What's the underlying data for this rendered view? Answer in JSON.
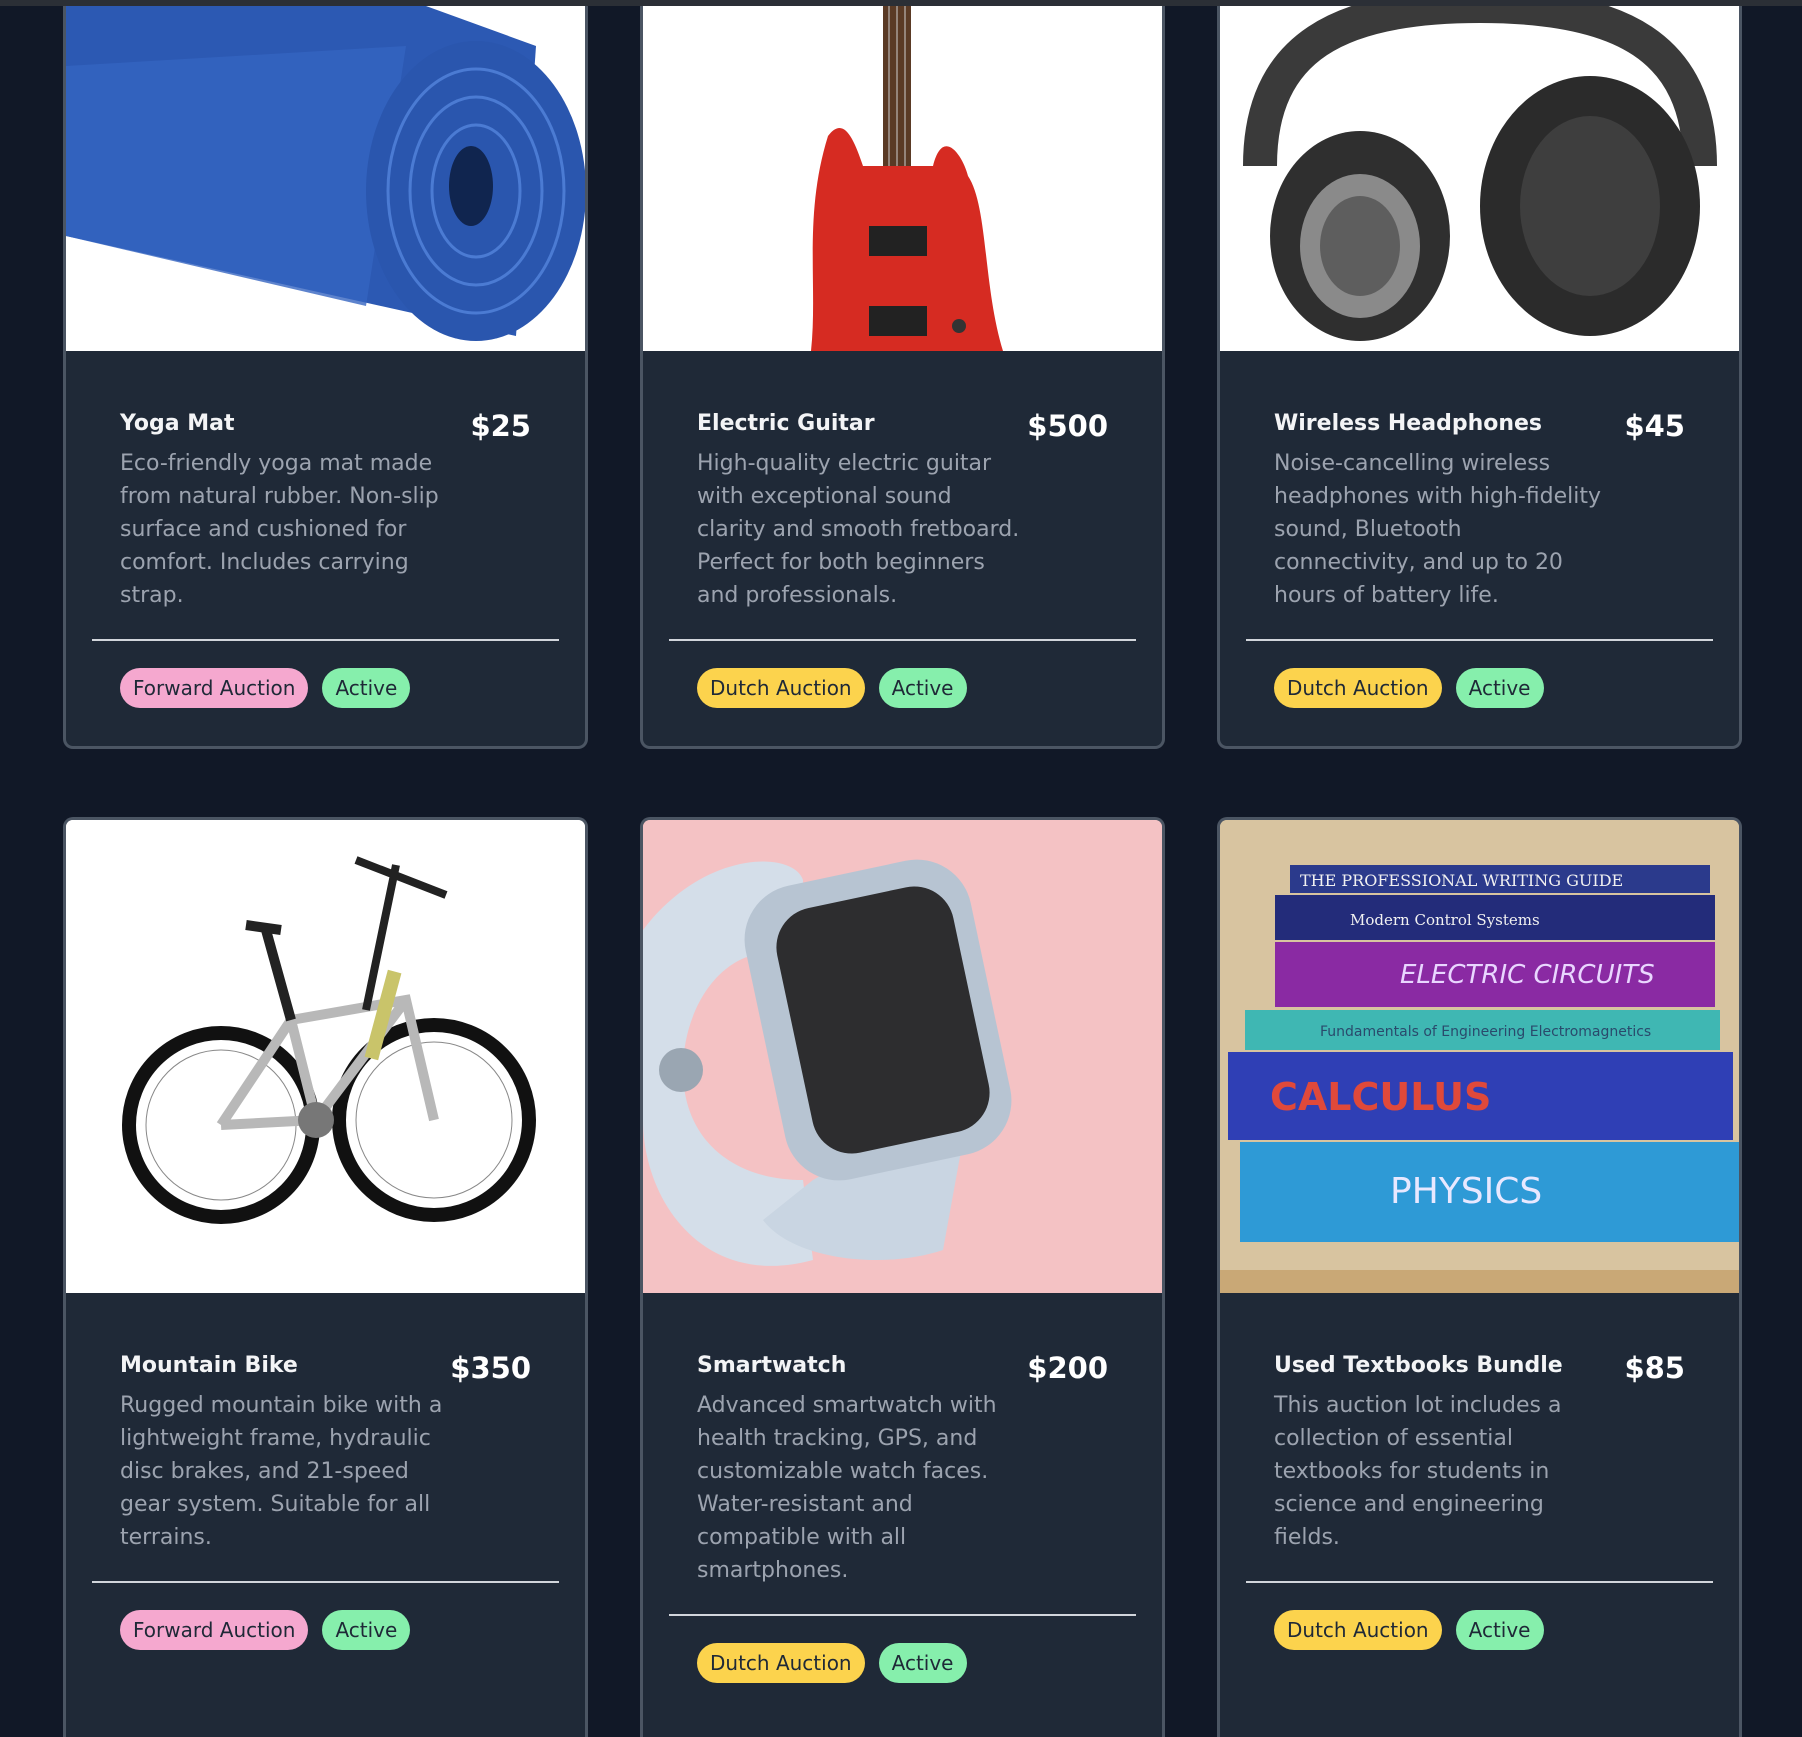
{
  "listings": [
    {
      "title": "Yoga Mat",
      "price": "$25",
      "description": "Eco-friendly yoga mat made from natural rubber. Non-slip surface and cushioned for comfort. Includes carrying strap.",
      "auction_type": "Forward Auction",
      "status": "Active",
      "image": "yoga-mat-image"
    },
    {
      "title": "Electric Guitar",
      "price": "$500",
      "description": "High-quality electric guitar with exceptional sound clarity and smooth fretboard. Perfect for both beginners and professionals.",
      "auction_type": "Dutch Auction",
      "status": "Active",
      "image": "electric-guitar-image"
    },
    {
      "title": "Wireless Headphones",
      "price": "$45",
      "description": "Noise-cancelling wireless headphones with high-fidelity sound, Bluetooth connectivity, and up to 20 hours of battery life.",
      "auction_type": "Dutch Auction",
      "status": "Active",
      "image": "headphones-image"
    },
    {
      "title": "Mountain Bike",
      "price": "$350",
      "description": "Rugged mountain bike with a lightweight frame, hydraulic disc brakes, and 21-speed gear system. Suitable for all terrains.",
      "auction_type": "Forward Auction",
      "status": "Active",
      "image": "mountain-bike-image"
    },
    {
      "title": "Smartwatch",
      "price": "$200",
      "description": "Advanced smartwatch with health tracking, GPS, and customizable watch faces. Water-resistant and compatible with all smartphones.",
      "auction_type": "Dutch Auction",
      "status": "Active",
      "image": "smartwatch-image"
    },
    {
      "title": "Used Textbooks Bundle",
      "price": "$85",
      "description": "This auction lot includes a collection of essential textbooks for students in science and engineering fields.",
      "auction_type": "Dutch Auction",
      "status": "Active",
      "image": "textbooks-image"
    }
  ],
  "book_spines": [
    "THE PROFESSIONAL WRITING GUIDE",
    "Modern Control Systems",
    "ELECTRIC CIRCUITS",
    "Fundamentals of Engineering Electromagnetics",
    "CALCULUS",
    "PHYSICS"
  ],
  "colors": {
    "page_bg": "#111827",
    "card_bg": "#1f2937",
    "card_border": "#4b5563",
    "forward_tag": "#f5a8cf",
    "dutch_tag": "#fcd34d",
    "active_tag": "#86efac"
  }
}
